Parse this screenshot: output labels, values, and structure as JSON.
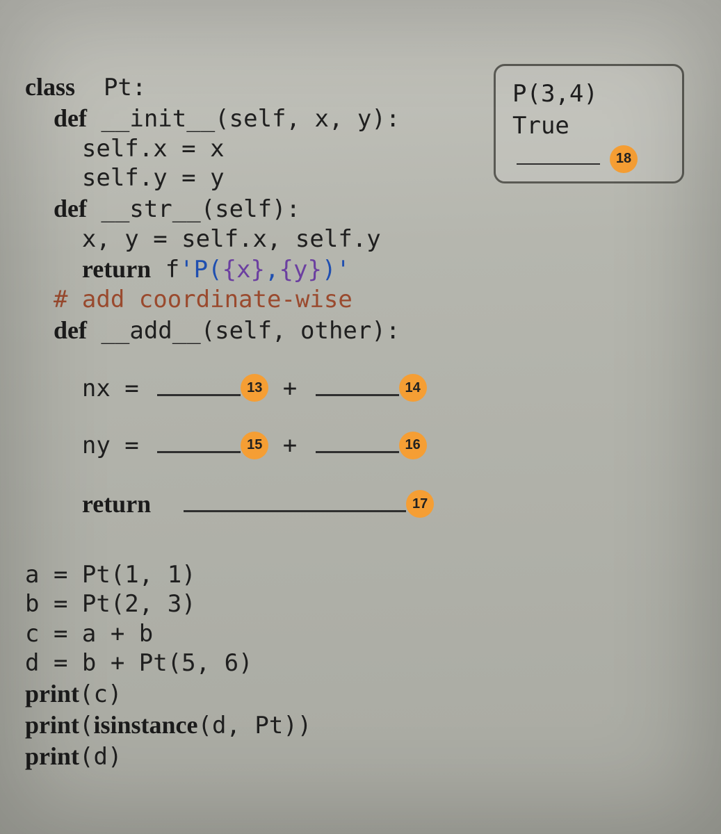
{
  "code": {
    "l1": {
      "kw": "class",
      "rest": "  Pt:"
    },
    "l2": {
      "indent": "  ",
      "kw": "def",
      "rest": " __init__(self, x, y):"
    },
    "l3": "    self.x = x",
    "l4": "    self.y = y",
    "l5": {
      "indent": "  ",
      "kw": "def",
      "rest": " __str__(self):"
    },
    "l6": "    x, y = self.x, self.y",
    "l7": {
      "indent": "    ",
      "kw": "return",
      "f_prefix": " f",
      "q1": "'",
      "p": "P(",
      "b1": "{x}",
      "comma": ",",
      "b2": "{y}",
      "close": ")",
      "q2": "'"
    },
    "l8": {
      "indent": "  ",
      "comment": "# add coordinate-wise"
    },
    "l9": {
      "indent": "  ",
      "kw": "def",
      "rest": " __add__(self, other):"
    },
    "nx": {
      "indent": "    ",
      "pre": "nx = ",
      "plus": " + "
    },
    "ny": {
      "indent": "    ",
      "pre": "ny = ",
      "plus": " + "
    },
    "ret": {
      "indent": "    ",
      "kw": "return",
      "sp": "  "
    },
    "l10": "a = Pt(1, 1)",
    "l11": "b = Pt(2, 3)",
    "l12": "c = a + b",
    "l13": "d = b + Pt(5, 6)",
    "l14a": {
      "kw": "print",
      "rest": "(c)"
    },
    "l14b": {
      "kw": "print",
      "open": "(",
      "inner_kw": "isinstance",
      "args": "(d, Pt))"
    },
    "l14c": {
      "kw": "print",
      "rest": "(d)"
    }
  },
  "badges": {
    "b13": "13",
    "b14": "14",
    "b15": "15",
    "b16": "16",
    "b17": "17",
    "b18": "18"
  },
  "output": {
    "line1": "P(3,4)",
    "line2": "True"
  }
}
